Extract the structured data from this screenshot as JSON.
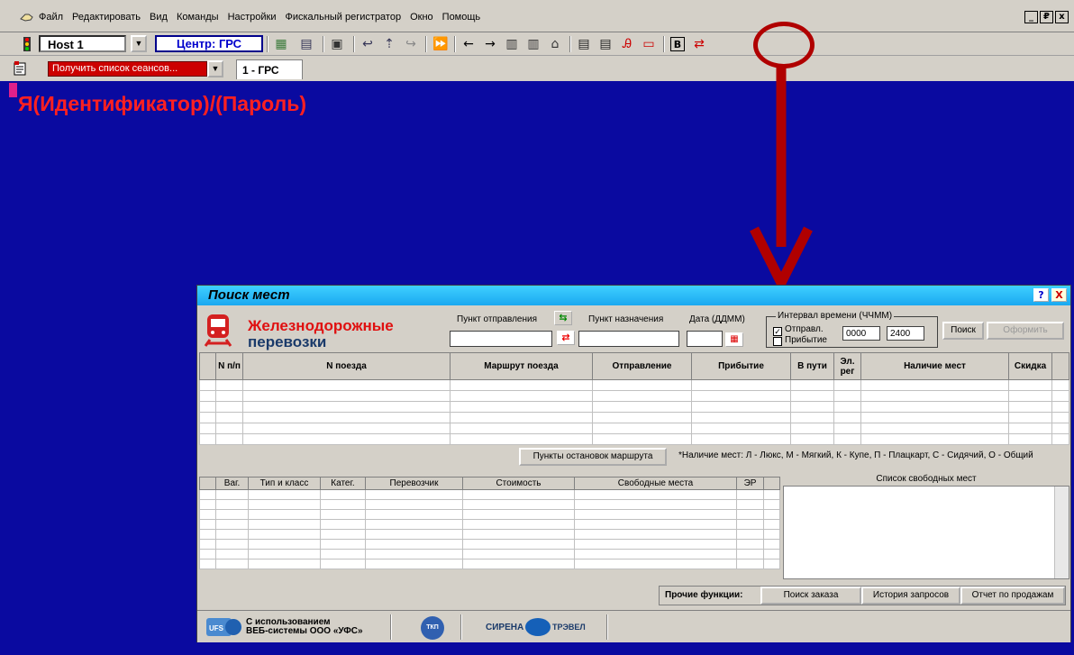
{
  "menubar": {
    "items": [
      "Файл",
      "Редактировать",
      "Вид",
      "Команды",
      "Настройки",
      "Фискальный регистратор",
      "Окно",
      "Помощь"
    ],
    "window_controls": [
      "_",
      "₽",
      "x"
    ]
  },
  "toolbar": {
    "host": "Host 1",
    "center": "Центр: ГРС"
  },
  "toolbar2": {
    "sessions_dropdown": "Получить список сеансов...",
    "tab": "1 - ГРС"
  },
  "terminal": {
    "text": "Я(Идентификатор)/(Пароль)"
  },
  "colors": {
    "terminal_bg": "#0a0aa0",
    "terminal_text": "#ff2020",
    "annotation": "#b00000",
    "title_bar": "#1aa8f0"
  },
  "dialog": {
    "title": "Поиск мест",
    "brand_line1": "Железнодорожные",
    "brand_line2": "перевозки",
    "departure_label": "Пункт отправления",
    "destination_label": "Пункт назначения",
    "date_label": "Дата (ДДММ)",
    "interval_label": "Интервал времени (ЧЧММ)",
    "departure_check": "Отправл.",
    "arrival_check": "Прибытие",
    "time_from": "0000",
    "time_to": "2400",
    "search_button": "Поиск",
    "order_button": "Оформить",
    "trains_columns": [
      "N п/п",
      "N поезда",
      "Маршрут поезда",
      "Отправление",
      "Прибытие",
      "В пути",
      "Эл. рег",
      "Наличие мест",
      "Скидка"
    ],
    "stops_button": "Пункты остановок маршрута",
    "seats_note": "*Наличие мест:  Л - Люкс, М - Мягкий, К - Купе, П - Плацкарт,  С - Сидячий, О - Общий",
    "cars_columns": [
      "Ваг.",
      "Тип и класс",
      "Катег.",
      "Перевозчик",
      "Стоимость",
      "Свободные места",
      "ЭР"
    ],
    "free_seats_title": "Список свободных мест",
    "other_functions_label": "Прочие функции:",
    "func_buttons": [
      "Поиск заказа",
      "История запросов",
      "Отчет по продажам"
    ],
    "footer_ufs_line1": "С использованием",
    "footer_ufs_line2": "ВЕБ-системы ООО «УФС»",
    "footer_ufs_logo": "UFS",
    "footer_tkp": "ТКП",
    "footer_sirena": "СИРЕНА",
    "footer_travel": "ТРЭВЕЛ"
  }
}
